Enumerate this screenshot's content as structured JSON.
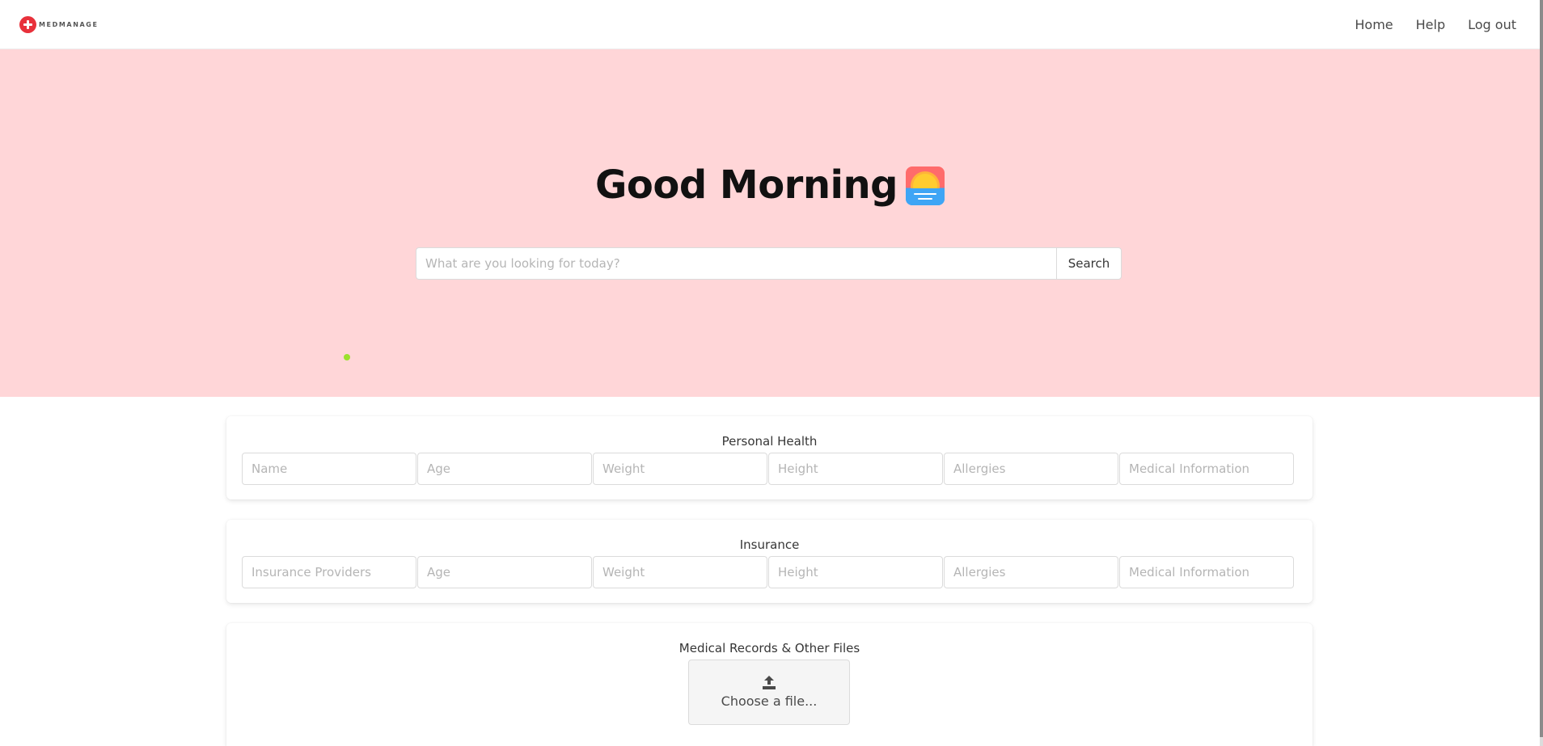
{
  "app": {
    "brand_name": "MEDMANAGE"
  },
  "nav": {
    "items": [
      {
        "label": "Home"
      },
      {
        "label": "Help"
      },
      {
        "label": "Log out"
      }
    ]
  },
  "hero": {
    "greeting": "Good Morning",
    "greeting_icon": "sunrise-icon",
    "search": {
      "placeholder": "What are you looking for today?",
      "value": "",
      "button_label": "Search"
    }
  },
  "personal_health": {
    "title": "Personal Health",
    "fields": [
      {
        "placeholder": "Name"
      },
      {
        "placeholder": "Age"
      },
      {
        "placeholder": "Weight"
      },
      {
        "placeholder": "Height"
      },
      {
        "placeholder": "Allergies"
      },
      {
        "placeholder": "Medical Information"
      }
    ]
  },
  "insurance": {
    "title": "Insurance",
    "fields": [
      {
        "placeholder": "Insurance Providers"
      },
      {
        "placeholder": "Age"
      },
      {
        "placeholder": "Weight"
      },
      {
        "placeholder": "Height"
      },
      {
        "placeholder": "Allergies"
      },
      {
        "placeholder": "Medical Information"
      }
    ]
  },
  "files": {
    "title": "Medical Records & Other Files",
    "choose_label": "Choose a file...",
    "icon": "upload-icon"
  },
  "colors": {
    "brand_red": "#e8313b",
    "hero_background": "#ffd6d8",
    "indicator_green": "#9be12d"
  }
}
